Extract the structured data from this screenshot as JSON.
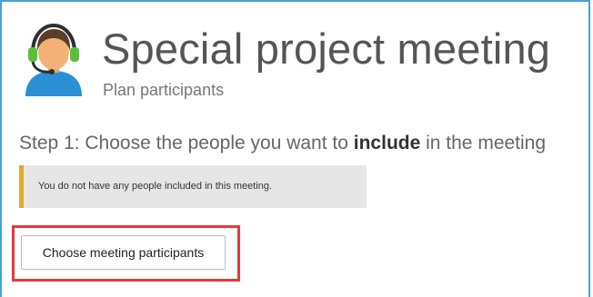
{
  "header": {
    "title": "Special project meeting",
    "subtitle": "Plan participants",
    "icon": "support-agent-headset-icon"
  },
  "step": {
    "prefix": "Step 1: Choose the people you want to ",
    "emphasis": "include",
    "suffix": " in the meeting"
  },
  "notice": {
    "text": "You do not have any people included in this meeting.",
    "accent_color": "#e3a931"
  },
  "actions": {
    "choose_label": "Choose meeting participants",
    "highlight_color": "#e53a3a"
  },
  "colors": {
    "frame_border": "#4a9fd6"
  }
}
